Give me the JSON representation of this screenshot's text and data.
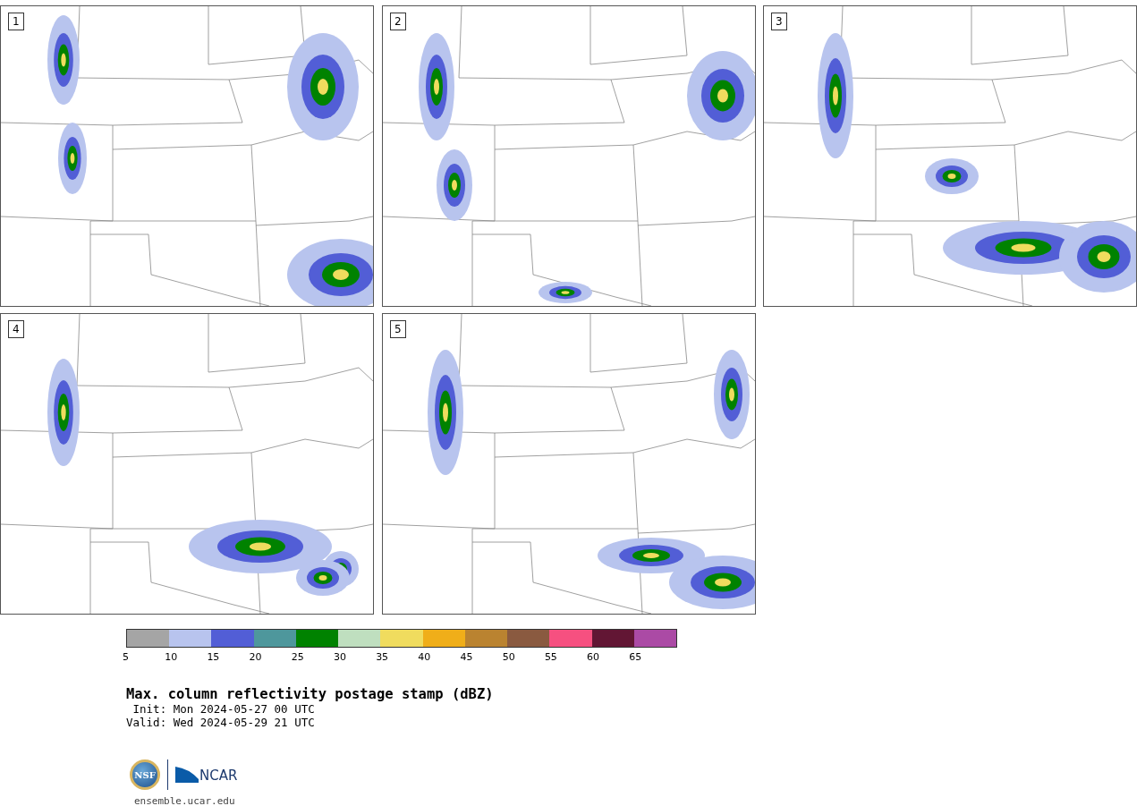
{
  "panels": [
    {
      "label": "1"
    },
    {
      "label": "2"
    },
    {
      "label": "3"
    },
    {
      "label": "4"
    },
    {
      "label": "5"
    }
  ],
  "colorbar": {
    "segments": [
      {
        "color": "#a5a5a5"
      },
      {
        "color": "#b8c4ee"
      },
      {
        "color": "#525ed6"
      },
      {
        "color": "#4e979c"
      },
      {
        "color": "#008200"
      },
      {
        "color": "#bfdfbf"
      },
      {
        "color": "#f0dc5e"
      },
      {
        "color": "#f0ae19"
      },
      {
        "color": "#ba8330"
      },
      {
        "color": "#8a5a40"
      },
      {
        "color": "#f65080"
      },
      {
        "color": "#621634"
      },
      {
        "color": "#ab4aa5"
      }
    ],
    "ticks": [
      "5",
      "10",
      "15",
      "20",
      "25",
      "30",
      "35",
      "40",
      "45",
      "50",
      "55",
      "60",
      "65"
    ]
  },
  "title": "Max. column reflectivity postage stamp (dBZ)",
  "init": " Init: Mon 2024-05-27 00 UTC",
  "valid": "Valid: Wed 2024-05-29 21 UTC",
  "logos": {
    "nsf": "NSF",
    "ncar": "NCAR"
  },
  "url": "ensemble.ucar.edu"
}
